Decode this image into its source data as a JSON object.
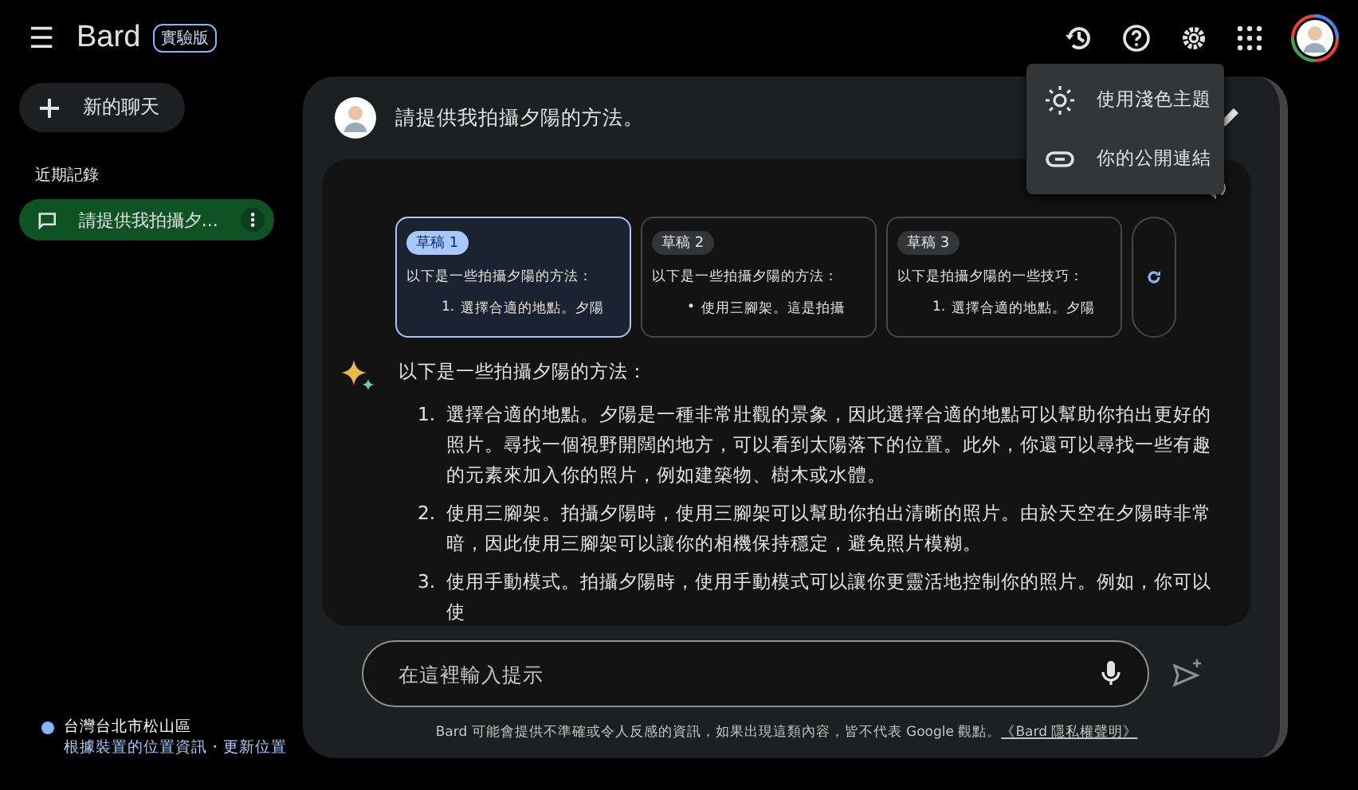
{
  "header": {
    "menu_icon": "☰",
    "brand": "Bard",
    "badge": "實驗版"
  },
  "sidebar": {
    "new_chat": "新的聊天",
    "recent_label": "近期記錄",
    "items": [
      {
        "title": "請提供我拍攝夕...",
        "selected": true
      }
    ],
    "location": {
      "place": "台灣台北市松山區",
      "source": "根據裝置的位置資訊",
      "separator": "・",
      "update": "更新位置"
    }
  },
  "settings_menu": [
    {
      "kind": "theme",
      "label": "使用淺色主題"
    },
    {
      "kind": "link",
      "label": "你的公開連結"
    }
  ],
  "prompt": "請提供我拍攝夕陽的方法。",
  "drafts": [
    {
      "label": "草稿 1",
      "selected": true,
      "intro": "以下是一些拍攝夕陽的方法：",
      "marker": "1.",
      "item": "選擇合適的地點。夕陽"
    },
    {
      "label": "草稿 2",
      "selected": false,
      "intro": "以下是一些拍攝夕陽的方法：",
      "marker": "•",
      "item": "使用三腳架。這是拍攝"
    },
    {
      "label": "草稿 3",
      "selected": false,
      "intro": "以下是拍攝夕陽的一些技巧：",
      "marker": "1.",
      "item": "選擇合適的地點。夕陽"
    }
  ],
  "response": {
    "intro": "以下是一些拍攝夕陽的方法：",
    "items": [
      {
        "marker": "1.",
        "text": "選擇合適的地點。夕陽是一種非常壯觀的景象，因此選擇合適的地點可以幫助你拍出更好的照片。尋找一個視野開闊的地方，可以看到太陽落下的位置。此外，你還可以尋找一些有趣的元素來加入你的照片，例如建築物、樹木或水體。"
      },
      {
        "marker": "2.",
        "text": "使用三腳架。拍攝夕陽時，使用三腳架可以幫助你拍出清晰的照片。由於天空在夕陽時非常暗，因此使用三腳架可以讓你的相機保持穩定，避免照片模糊。"
      },
      {
        "marker": "3.",
        "text": "使用手動模式。拍攝夕陽時，使用手動模式可以讓你更靈活地控制你的照片。例如，你可以使"
      }
    ]
  },
  "input": {
    "placeholder": "在這裡輸入提示"
  },
  "disclaimer": {
    "text": "Bard 可能會提供不準確或令人反感的資訊，如果出現這類內容，皆不代表 Google 觀點。",
    "link": "《Bard 隱私權聲明》"
  }
}
